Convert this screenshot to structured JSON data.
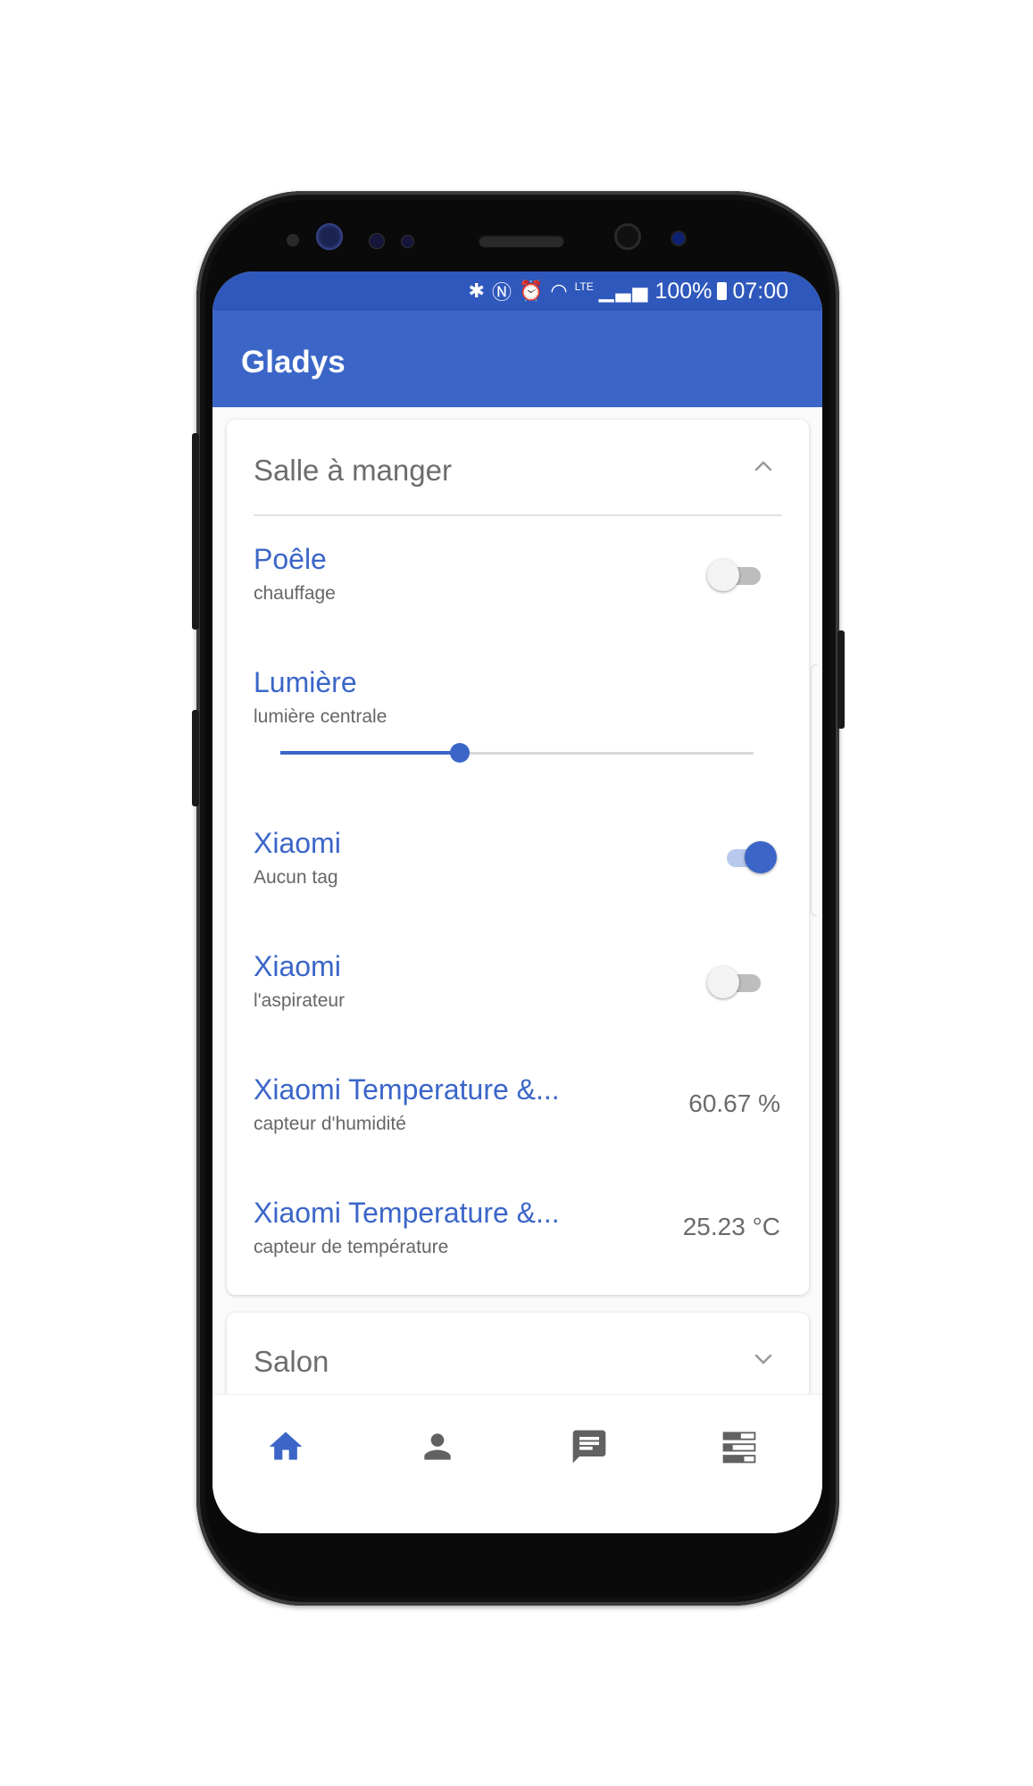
{
  "status_bar": {
    "icons": [
      "bluetooth-icon",
      "nfc-icon",
      "alarm-icon",
      "wifi-icon",
      "lte-icon",
      "signal-icon",
      "battery-icon"
    ],
    "wifi_label": "LTE",
    "battery": "100%",
    "time": "07:00"
  },
  "app_bar": {
    "title": "Gladys"
  },
  "rooms": [
    {
      "name": "Salle à manger",
      "expanded": true,
      "devices": [
        {
          "name": "Poêle",
          "tag": "chauffage",
          "control": "toggle",
          "on": false
        },
        {
          "name": "Lumière",
          "tag": "lumière centrale",
          "control": "slider",
          "level": 0.38
        },
        {
          "name": "Xiaomi",
          "tag": "Aucun tag",
          "control": "toggle",
          "on": true
        },
        {
          "name": "Xiaomi",
          "tag": "l'aspirateur",
          "control": "toggle",
          "on": false
        },
        {
          "name": "Xiaomi Temperature &...",
          "tag": "capteur d'humidité",
          "control": "value",
          "value": "60.67 %"
        },
        {
          "name": "Xiaomi Temperature &...",
          "tag": "capteur de température",
          "control": "value",
          "value": "25.23 °C"
        }
      ]
    },
    {
      "name": "Salon",
      "expanded": false
    }
  ],
  "bottom_nav": {
    "items": [
      {
        "icon": "home-icon",
        "active": true
      },
      {
        "icon": "person-icon",
        "active": false
      },
      {
        "icon": "chat-icon",
        "active": false
      },
      {
        "icon": "dashboard-icon",
        "active": false
      }
    ]
  },
  "colors": {
    "primary": "#3b66c8",
    "status_bar": "#2f58bd",
    "text_secondary": "#6d6d6d",
    "toggle_off": "#bdbdbd"
  }
}
